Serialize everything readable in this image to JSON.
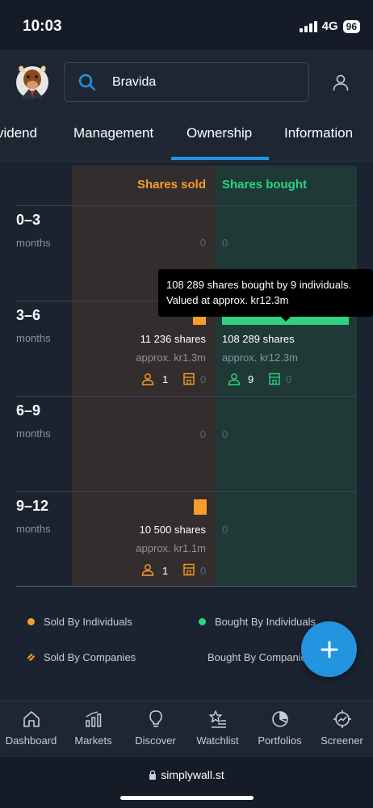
{
  "status_bar": {
    "time": "10:03",
    "network": "4G",
    "battery": "96"
  },
  "header": {
    "search_value": "Bravida"
  },
  "tabs": [
    {
      "label": "vidend"
    },
    {
      "label": "Management"
    },
    {
      "label": "Ownership",
      "active": true
    },
    {
      "label": "Information"
    }
  ],
  "columns": {
    "sold": "Shares sold",
    "bought": "Shares bought"
  },
  "rows": [
    {
      "range": "0–3",
      "unit": "months",
      "sold_zero": "0",
      "bought_zero": "0"
    },
    {
      "range": "3–6",
      "unit": "months",
      "sold_shares": "11 236 shares",
      "sold_value": "approx. kr1.3m",
      "sold_individuals": "1",
      "sold_companies": "0",
      "bought_shares": "108 289 shares",
      "bought_value": "approx. kr12.3m",
      "bought_individuals": "9",
      "bought_companies": "0"
    },
    {
      "range": "6–9",
      "unit": "months",
      "sold_zero": "0",
      "bought_zero": "0"
    },
    {
      "range": "9–12",
      "unit": "months",
      "sold_shares": "10 500 shares",
      "sold_value": "approx. kr1.1m",
      "sold_individuals": "1",
      "sold_companies": "0",
      "bought_zero": "0"
    }
  ],
  "tooltip": {
    "line1": "108 289 shares bought by 9 individuals.",
    "line2": "Valued at approx. kr12.3m"
  },
  "legend": {
    "sold_individuals": "Sold By Individuals",
    "bought_individuals": "Bought By Individuals",
    "sold_companies": "Sold By Companies",
    "bought_companies": "Bought By Companies"
  },
  "colors": {
    "sold": "#f99d2a",
    "bought": "#2dd383",
    "accent": "#2394df"
  },
  "nav": [
    {
      "label": "Dashboard",
      "icon": "home-icon"
    },
    {
      "label": "Markets",
      "icon": "markets-icon"
    },
    {
      "label": "Discover",
      "icon": "lightbulb-icon"
    },
    {
      "label": "Watchlist",
      "icon": "watchlist-icon"
    },
    {
      "label": "Portfolios",
      "icon": "pie-icon"
    },
    {
      "label": "Screener",
      "icon": "screener-icon"
    }
  ],
  "browser": {
    "url": "simplywall.st"
  }
}
